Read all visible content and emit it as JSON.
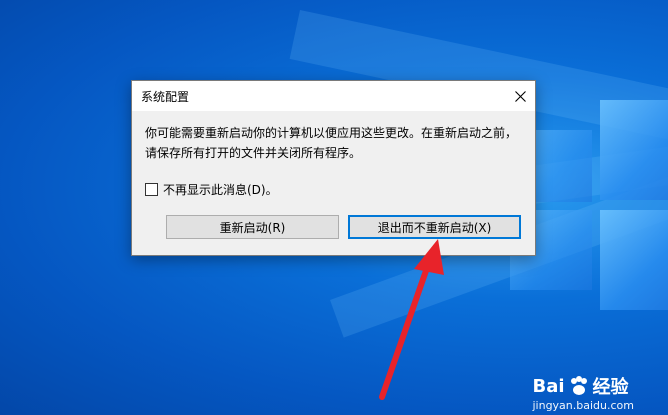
{
  "dialog": {
    "title": "系统配置",
    "message": "你可能需要重新启动你的计算机以便应用这些更改。在重新启动之前，请保存所有打开的文件并关闭所有程序。",
    "checkbox_label": "不再显示此消息(D)。",
    "checkbox_checked": false,
    "restart_label": "重新启动(R)",
    "exit_label": "退出而不重新启动(X)"
  },
  "watermark": {
    "brand_left": "Bai",
    "brand_right": "经验",
    "url": "jingyan.baidu.com"
  },
  "colors": {
    "desktop": "#0a6fd8",
    "focus_border": "#0078d7",
    "arrow": "#e8232a"
  },
  "icons": [
    "close-icon",
    "checkbox-icon",
    "paw-icon",
    "red-arrow"
  ]
}
